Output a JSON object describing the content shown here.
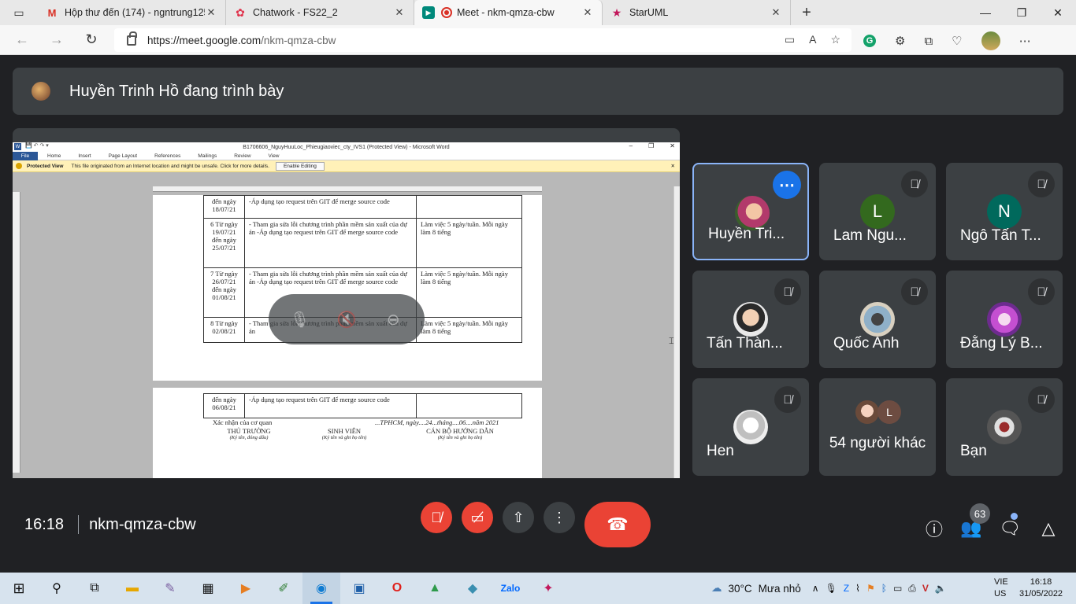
{
  "browser": {
    "tabs": [
      {
        "title": "Hộp thư đến (174) - ngntrung125",
        "icon": "gmail-icon",
        "active": false
      },
      {
        "title": "Chatwork - FS22_2",
        "icon": "chatwork-icon",
        "active": false
      },
      {
        "title": "Meet - nkm-qmza-cbw",
        "icon": "meet-icon",
        "active": true
      },
      {
        "title": "StarUML",
        "icon": "staruml-icon",
        "active": false
      }
    ],
    "url_host": "https://meet.google.com",
    "url_path": "/nkm-qmza-cbw"
  },
  "meet": {
    "presenter_text": "Huyền Trinh Hồ đang trình bày",
    "time": "16:18",
    "meeting_code": "nkm-qmza-cbw",
    "participant_count": "63",
    "participants": [
      {
        "name": "Huyền Tri...",
        "avatar": "photo",
        "speaking": true
      },
      {
        "name": "Lam Ngu...",
        "initial": "L",
        "color": "#33691e"
      },
      {
        "name": "Ngô Tấn T...",
        "initial": "N",
        "color": "#00695c"
      },
      {
        "name": "Tấn Thàn...",
        "avatar": "photo"
      },
      {
        "name": "Quốc Anh",
        "avatar": "photo"
      },
      {
        "name": "Đằng Lý B...",
        "avatar": "photo"
      },
      {
        "name": "Hen",
        "avatar": "photo"
      },
      {
        "name": "54 người khác",
        "initial": "L"
      },
      {
        "name": "Bạn",
        "avatar": "photo"
      }
    ]
  },
  "word": {
    "title": "B1706606_NguyHuuLoc_Phieugiaoviec_cty_IVS1 (Protected View) - Microsoft Word",
    "ribbon": [
      "File",
      "Home",
      "Insert",
      "Page Layout",
      "References",
      "Mailings",
      "Review",
      "View"
    ],
    "protected_label": "Protected View",
    "protected_msg": "This file originated from an Internet location and might be unsafe. Click for more details.",
    "enable_editing": "Enable Editing",
    "rows": [
      {
        "week": "đến ngày 18/07/21",
        "task": "-Áp dụng tạo request trên GIT để merge source code",
        "note": ""
      },
      {
        "week": "6 Từ ngày 19/07/21 đến ngày 25/07/21",
        "task": "- Tham gia sửa lỗi chương trình phần mềm sản xuất của dự án -Áp dụng tạo request trên GIT để merge source code",
        "note": "Làm việc 5 ngày/tuần. Mỗi ngày làm 8 tiếng"
      },
      {
        "week": "7 Từ ngày 26/07/21 đến ngày 01/08/21",
        "task": "- Tham gia sửa lỗi chương trình phần mềm sản xuất của dự án -Áp dụng tạo request trên GIT để merge source code",
        "note": "Làm việc 5 ngày/tuần. Mỗi ngày làm 8 tiếng"
      },
      {
        "week": "8 Từ ngày 02/08/21",
        "task": "- Tham gia sửa lỗi chương trình phần mềm sản xuất của dự án",
        "note": "Làm việc 5 ngày/tuần. Mỗi ngày làm 8 tiếng"
      }
    ],
    "page2_row": {
      "week": "đến ngày 06/08/21",
      "task": "-Áp dụng tạo request trên GIT để merge source code",
      "note": ""
    },
    "confirm": "Xác nhận của cơ quan",
    "date_line": "...TPHCM, ngày....24...tháng....06....năm 2021",
    "sig1": "THỦ TRƯỞNG",
    "sig1_note": "(Ký tên, đóng dấu)",
    "sig2": "SINH VIÊN",
    "sig2_note": "(Ký tên và ghi họ tên)",
    "sig3": "CÁN BỘ HƯỚNG DẪN",
    "sig3_note": "(Ký tên và ghi họ tên)"
  },
  "taskbar": {
    "weather": "30°C",
    "weather_desc": "Mưa nhỏ",
    "lang_1": "VIE",
    "lang_2": "US",
    "time": "16:18",
    "date": "31/05/2022"
  }
}
